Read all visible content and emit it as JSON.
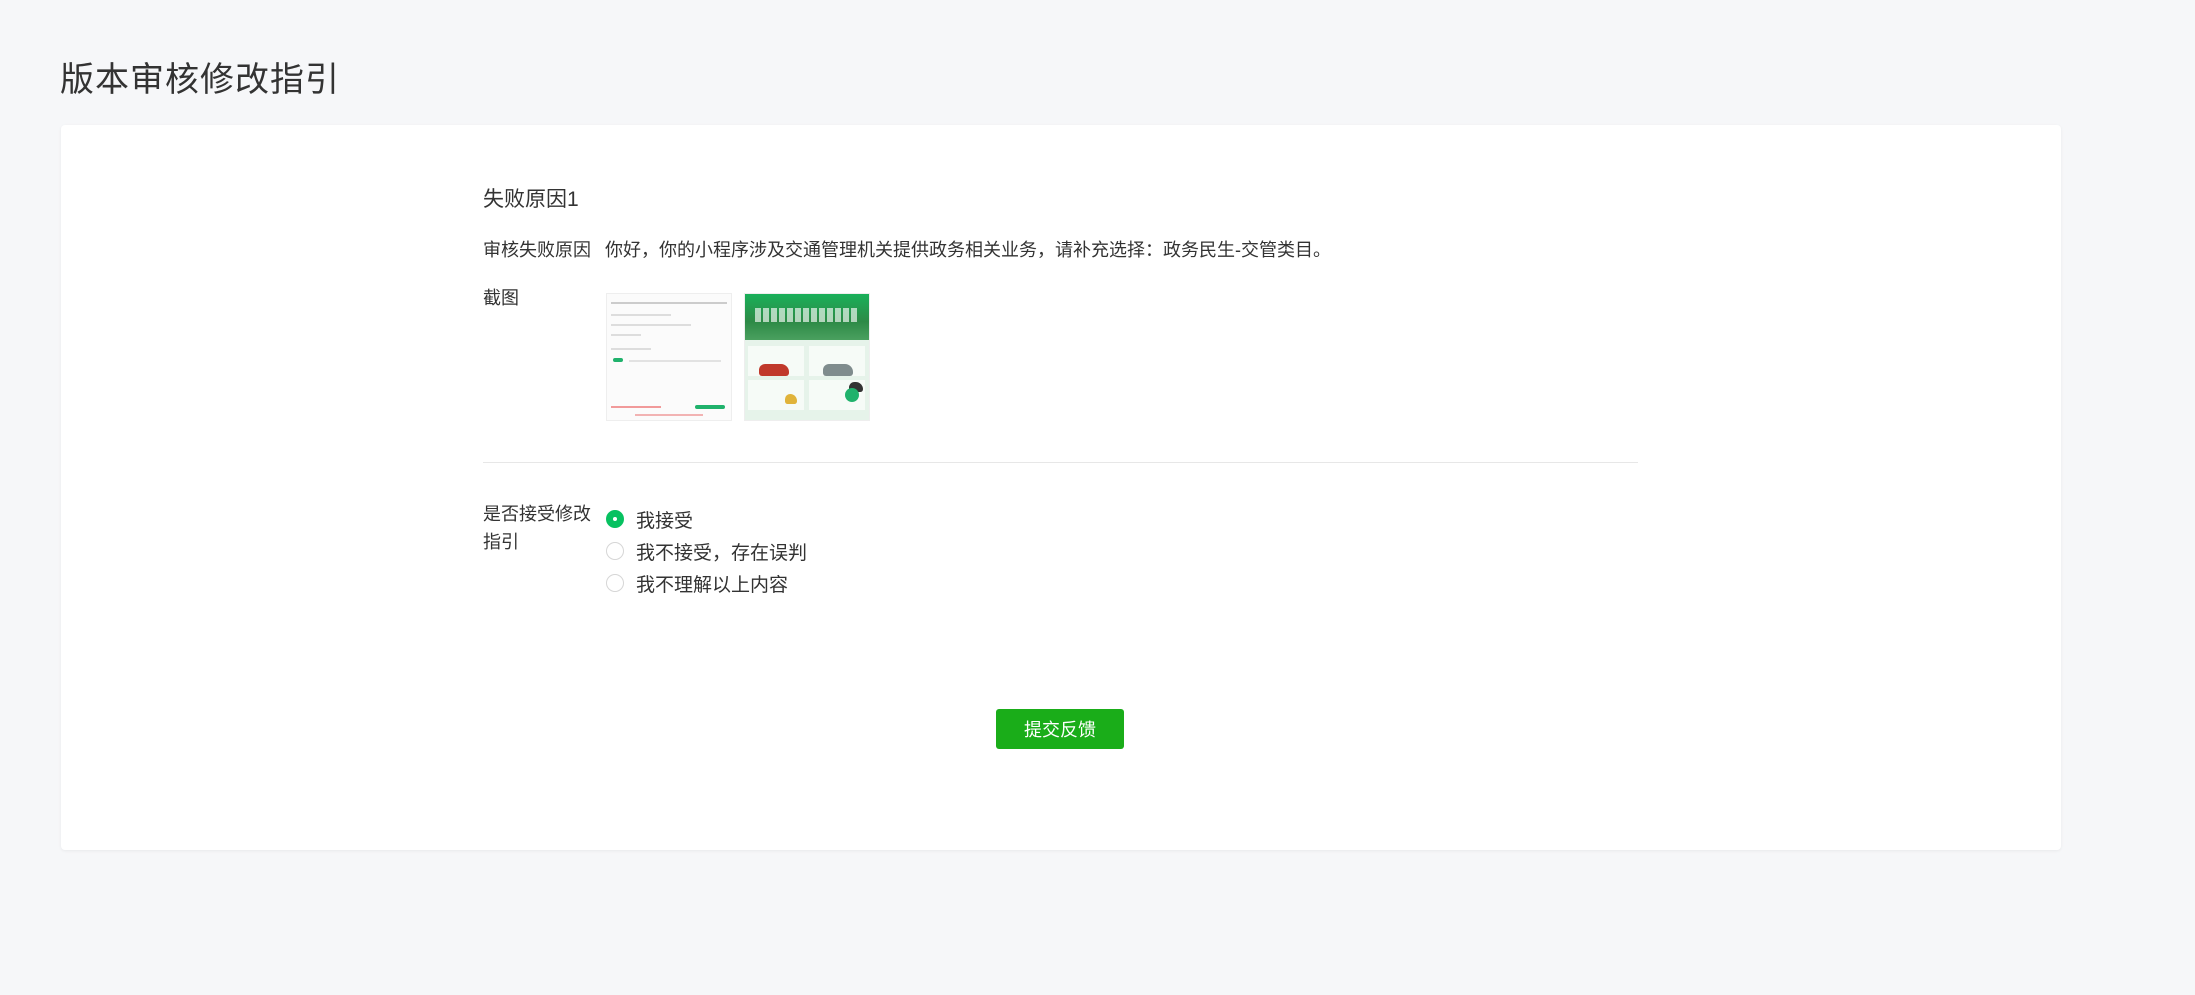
{
  "page": {
    "title": "版本审核修改指引"
  },
  "failure": {
    "section_title": "失败原因1",
    "reason_label": "审核失败原因",
    "reason_text": "你好，你的小程序涉及交通管理机关提供政务相关业务，请补充选择：政务民生-交管类目。",
    "screenshot_label": "截图"
  },
  "accept": {
    "label": "是否接受修改指引",
    "options": [
      {
        "label": "我接受",
        "checked": true
      },
      {
        "label": "我不接受，存在误判",
        "checked": false
      },
      {
        "label": "我不理解以上内容",
        "checked": false
      }
    ]
  },
  "actions": {
    "submit_label": "提交反馈"
  },
  "colors": {
    "primary": "#1aad19",
    "radio_checked": "#07c160",
    "background": "#f6f7f9"
  }
}
